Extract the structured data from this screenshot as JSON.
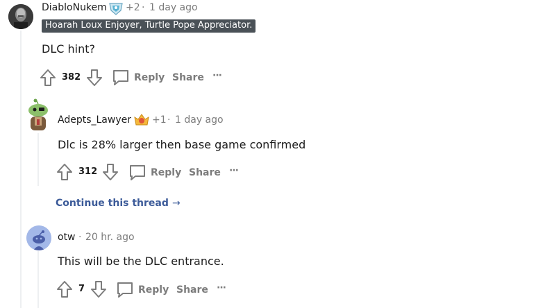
{
  "comments": [
    {
      "username": "DiabloNukem",
      "awards": "+2",
      "separator": "·",
      "time": "1 day ago",
      "flair": "Hoarah Loux Enjoyer, Turtle Pope Appreciator.",
      "body": "DLC hint?",
      "votes": "382",
      "reply_label": "Reply",
      "share_label": "Share",
      "more_label": "···"
    },
    {
      "username": "Adepts_Lawyer",
      "awards": "+1",
      "separator": "·",
      "time": "1 day ago",
      "body": "Dlc is 28% larger then base game confirmed",
      "votes": "312",
      "reply_label": "Reply",
      "share_label": "Share",
      "more_label": "···"
    },
    {
      "username": "otw",
      "separator": "·",
      "time": "20 hr. ago",
      "body": "This will be the DLC entrance.",
      "votes": "7",
      "reply_label": "Reply",
      "share_label": "Share",
      "more_label": "···"
    }
  ],
  "continue_thread": "Continue this thread",
  "continue_arrow": "→",
  "colors": {
    "text": "#1c1c1c",
    "meta": "#7c7c7c",
    "link": "#3c5b99",
    "flair_bg": "#4a5157",
    "thread_line": "#edeff1"
  },
  "icons": [
    "user-avatar-icon",
    "snoo-avatar-icon",
    "award-icon",
    "upvote-icon",
    "downvote-icon",
    "comment-icon",
    "more-icon"
  ]
}
